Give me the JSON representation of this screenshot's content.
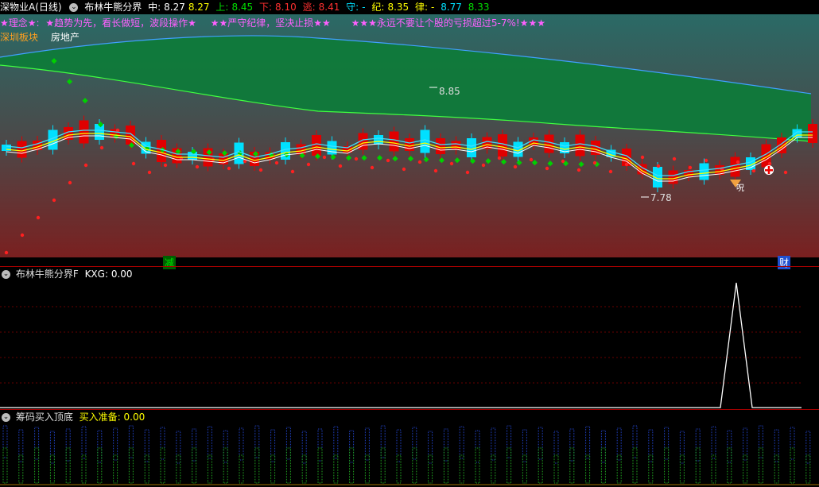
{
  "colors": {
    "up": "#e00000",
    "down": "#00e0ff",
    "green": "#00d000",
    "yellow": "#ffff00",
    "magenta": "#ff60ff",
    "white": "#ffffff"
  },
  "header": {
    "stock": "深物业A(日线)",
    "indicator": "布林牛熊分界",
    "mid_label": "中:",
    "mid_value": "8.27",
    "mid_value2": "8.27",
    "up_label": "上:",
    "up_value": "8.45",
    "down_label": "下:",
    "down_value": "8.10",
    "escape_label": "逃:",
    "escape_value": "8.41",
    "guard_label": "守:",
    "guard_value": "-",
    "ji_label": "纪:",
    "ji_value": "8.35",
    "lv_label": "律:",
    "lv_value": "-",
    "last_value": "8.77",
    "last_value2": "8.33"
  },
  "banner": {
    "philosophy_label": "★理念★:",
    "text1": "★趋势为先，看长做短，波段操作★",
    "text2": "★★严守纪律，坚决止损★★",
    "text3": "★★★永远不要让个股的亏损超过5-7%!★★★"
  },
  "sector": {
    "label": "深圳板块",
    "value": "房地产"
  },
  "annotations": {
    "high_price": "8.85",
    "low_price": "7.78",
    "marker_jian": "减",
    "marker_cai": "财",
    "marker_kou": "呪"
  },
  "panel2": {
    "title": "布林牛熊分界F",
    "kxg_label": "KXG:",
    "kxg_value": "0.00"
  },
  "panel3": {
    "title": "筹码买入顶底",
    "buy_label": "买入准备:",
    "buy_value": "0.00"
  }
}
